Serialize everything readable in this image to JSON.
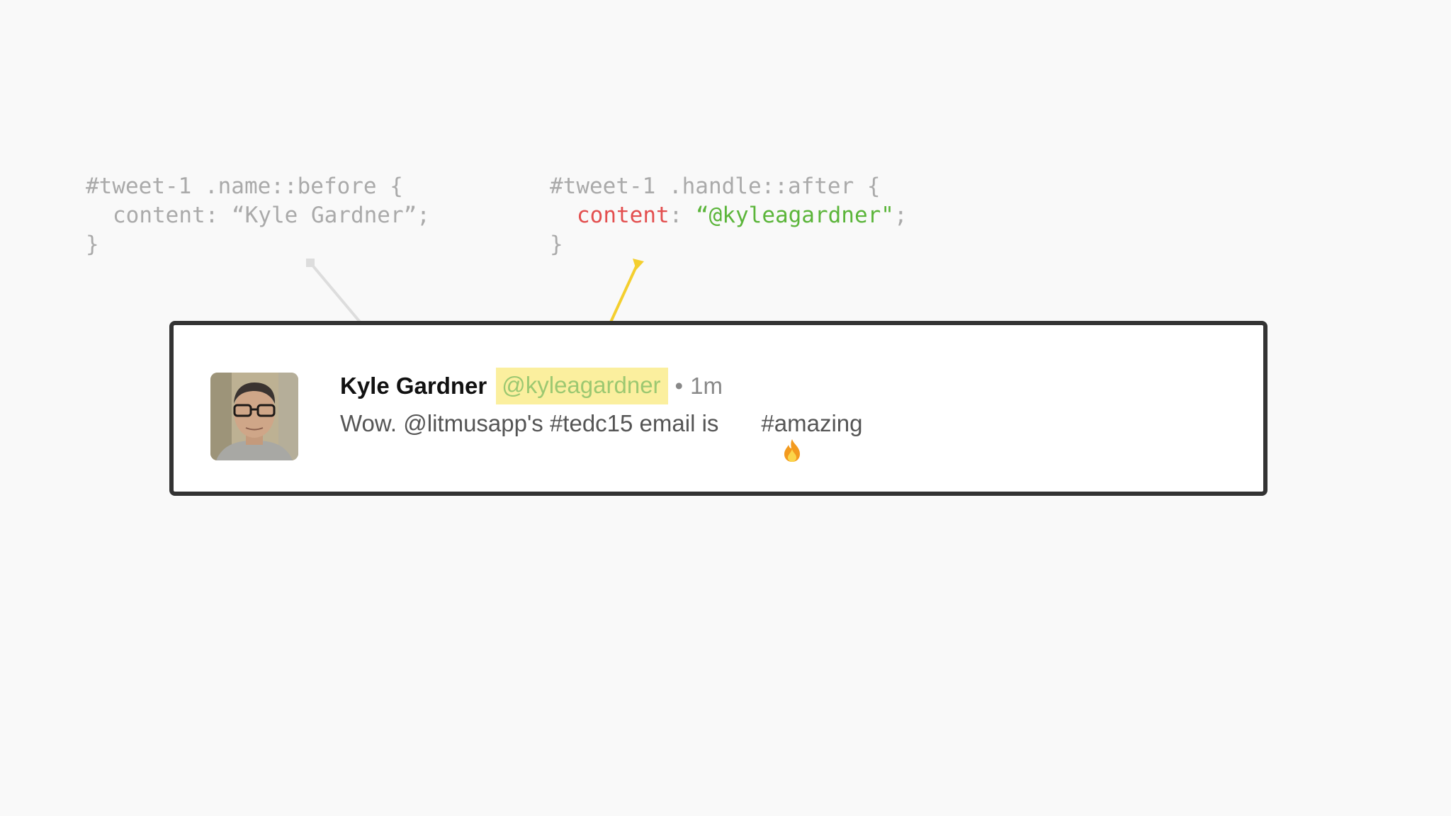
{
  "code_left": {
    "line1": "#tweet-1 .name::before {",
    "line2_property": "content:",
    "line2_value": "“Kyle Gardner”;",
    "line3": "}"
  },
  "code_right": {
    "line1": "#tweet-1 .handle::after {",
    "line2_property": "content",
    "line2_colon": ":",
    "line2_value": "“@kyleagardner\"",
    "line2_semicolon": ";",
    "line3": "}"
  },
  "colors": {
    "background": "#f9f9f9",
    "card_border": "#333333",
    "handle_highlight": "#fbef9e",
    "handle_text": "#9cc871",
    "active_property": "#e34f4f",
    "active_value": "#5bb53a",
    "connector_inactive": "#dddddd",
    "connector_active": "#f4cf2f"
  },
  "tweet": {
    "name": "Kyle Gardner",
    "handle": "@kyleagardner",
    "separator": "•",
    "time": "1m",
    "text_before_icon": "Wow. @litmusapp's #tedc15 email is",
    "icon": "fire-icon",
    "text_after_icon": "#amazing"
  }
}
